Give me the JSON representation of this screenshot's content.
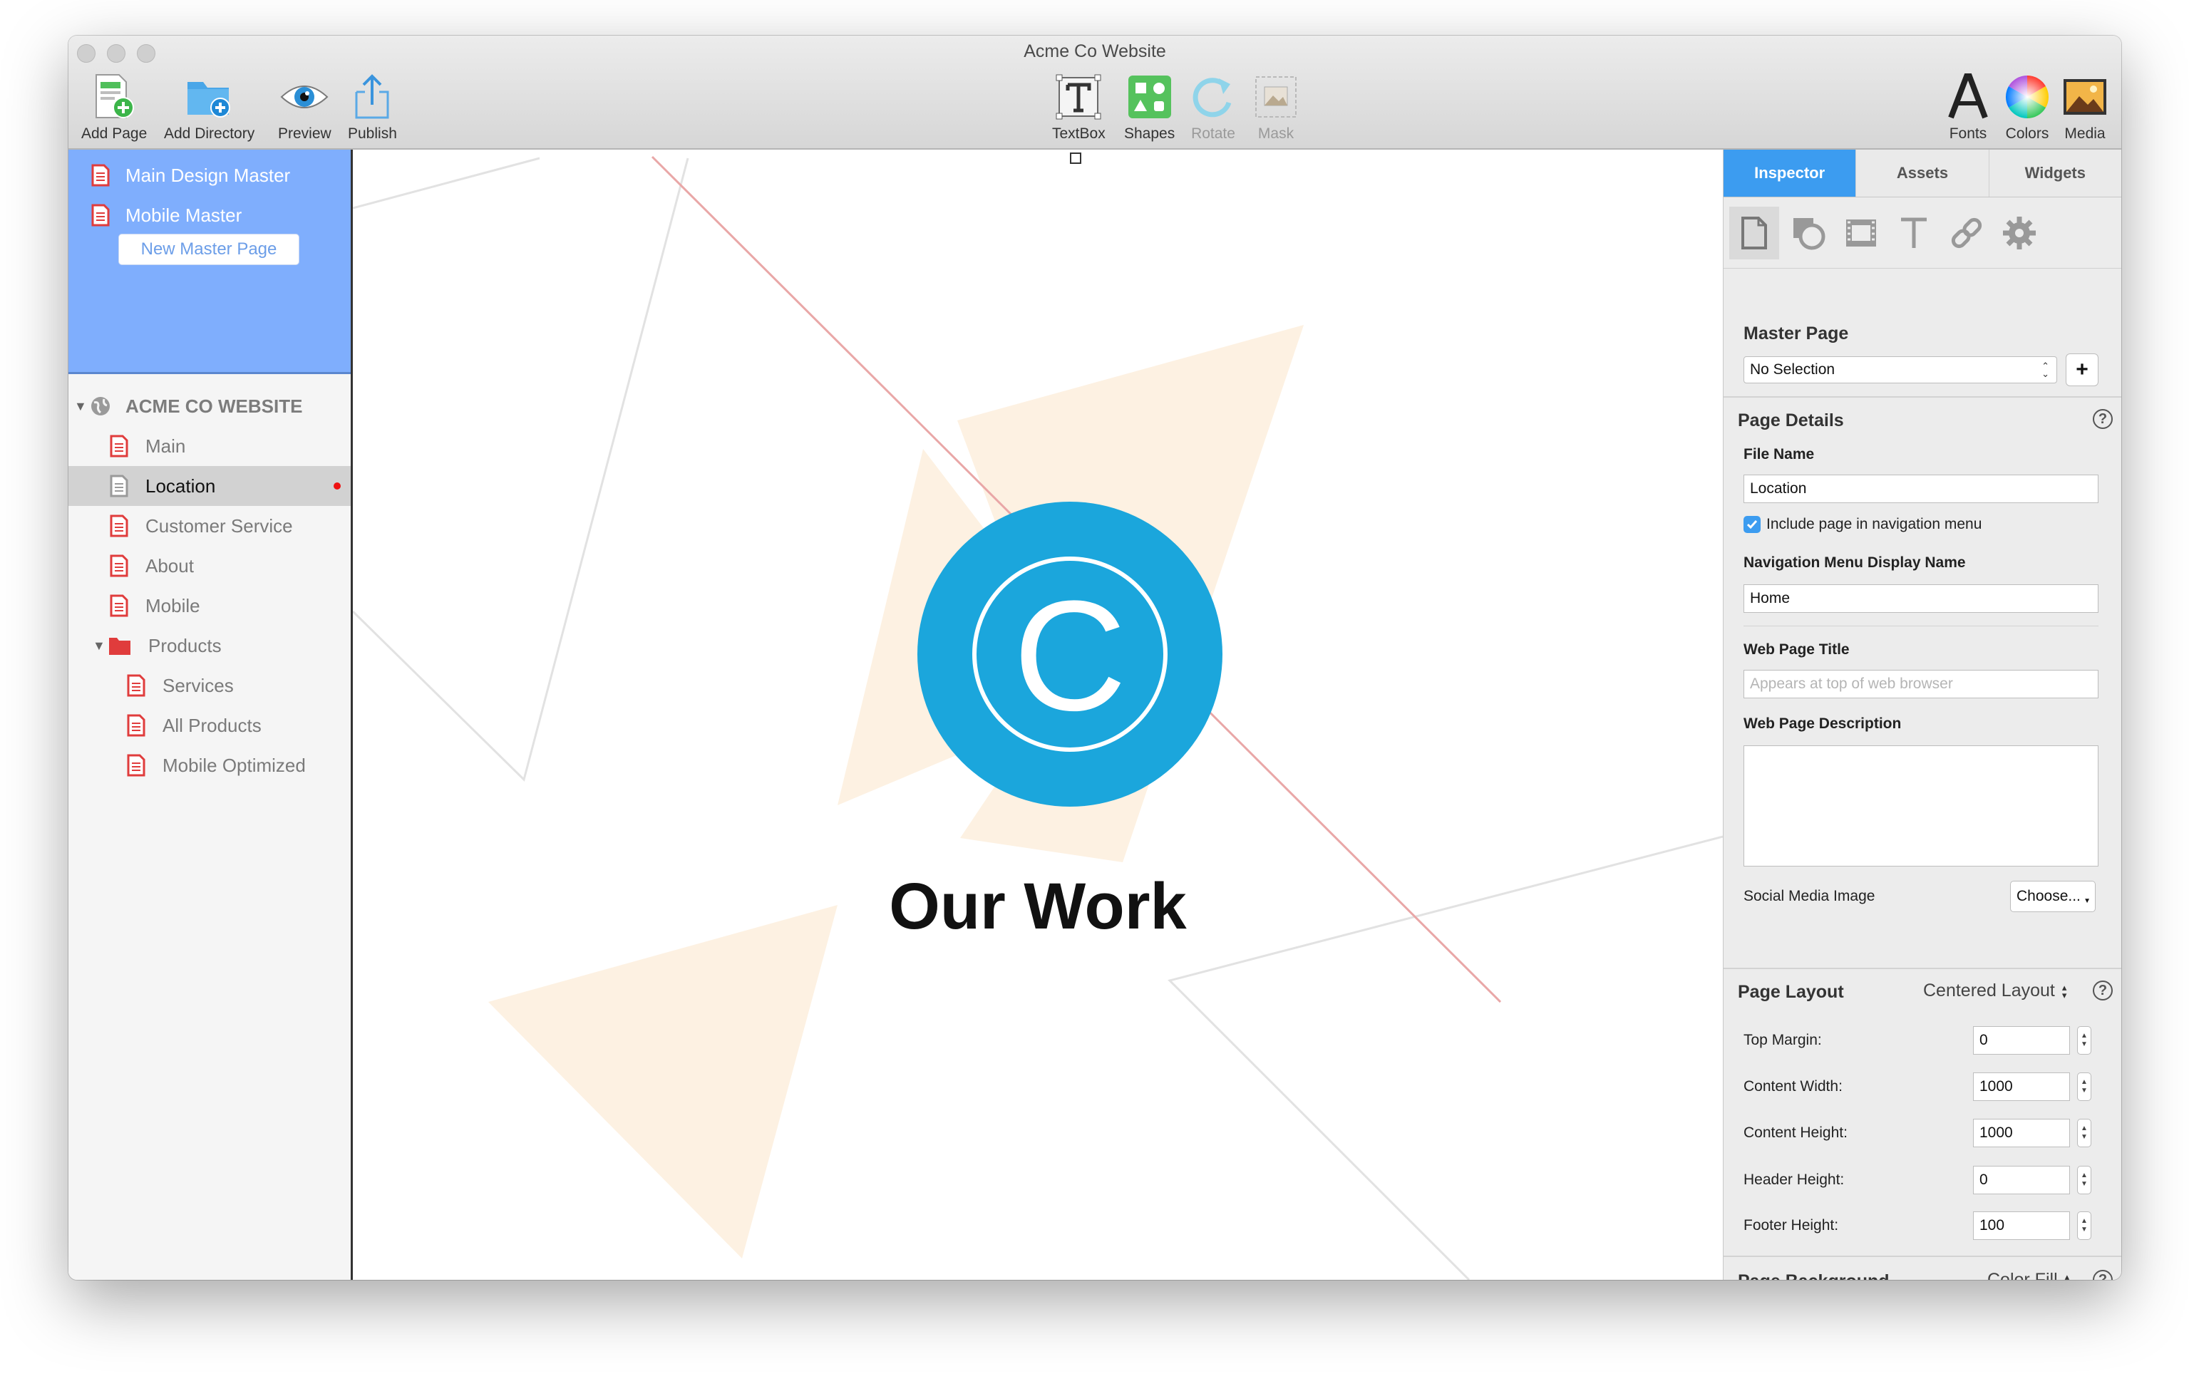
{
  "window": {
    "title": "Acme Co Website"
  },
  "toolbar": {
    "add_page": "Add Page",
    "add_directory": "Add Directory",
    "preview": "Preview",
    "publish": "Publish",
    "textbox": "TextBox",
    "shapes": "Shapes",
    "rotate": "Rotate",
    "mask": "Mask",
    "fonts": "Fonts",
    "colors": "Colors",
    "media": "Media"
  },
  "masters": {
    "items": [
      "Main Design Master",
      "Mobile Master"
    ],
    "new_button": "New Master Page"
  },
  "site": {
    "title": "ACME CO WEBSITE",
    "pages": [
      "Main",
      "Location",
      "Customer Service",
      "About",
      "Mobile"
    ],
    "selected_page": "Location",
    "folder": "Products",
    "folder_pages": [
      "Services",
      "All Products",
      "Mobile Optimized"
    ]
  },
  "canvas": {
    "heading": "Our Work",
    "logo_letter": "C"
  },
  "inspector": {
    "tabs": [
      "Inspector",
      "Assets",
      "Widgets"
    ],
    "active_tab": "Inspector",
    "master_page": {
      "heading": "Master Page",
      "value": "No Selection",
      "add": "+"
    },
    "page_details": {
      "heading": "Page Details",
      "help": "?",
      "file_name_label": "File Name",
      "file_name": "Location",
      "include_nav_label": "Include page in navigation menu",
      "include_nav_checked": true,
      "nav_display_label": "Navigation Menu Display Name",
      "nav_display_value": "Home",
      "web_title_label": "Web Page Title",
      "web_title_placeholder": "Appears at top of web browser",
      "web_desc_label": "Web Page Description",
      "web_desc_value": "",
      "social_label": "Social Media Image",
      "social_button": "Choose..."
    },
    "page_layout": {
      "heading": "Page Layout",
      "mode": "Centered Layout",
      "help": "?",
      "top_margin_label": "Top Margin:",
      "top_margin": "0",
      "content_width_label": "Content Width:",
      "content_width": "1000",
      "content_height_label": "Content Height:",
      "content_height": "1000",
      "header_height_label": "Header Height:",
      "header_height": "0",
      "footer_height_label": "Footer Height:",
      "footer_height": "100"
    },
    "page_background": {
      "heading": "Page Background",
      "mode": "Color Fill",
      "help": "?"
    }
  },
  "colors": {
    "accent": "#3c9cf0",
    "master_panel": "#7faefd",
    "logo_circle": "#1ba6dc",
    "page_icon": "#e03c3c",
    "triangle_fill": "#fdf1e2",
    "guide_line": "#e9a7a7"
  },
  "icons": {
    "add_page": "add-page-icon",
    "add_directory": "add-directory-icon",
    "preview": "eye-icon",
    "publish": "publish-icon",
    "textbox": "textbox-icon",
    "shapes": "shapes-icon",
    "rotate": "rotate-icon",
    "mask": "mask-icon",
    "fonts": "fonts-icon",
    "colors": "color-wheel-icon",
    "media": "media-icon"
  }
}
